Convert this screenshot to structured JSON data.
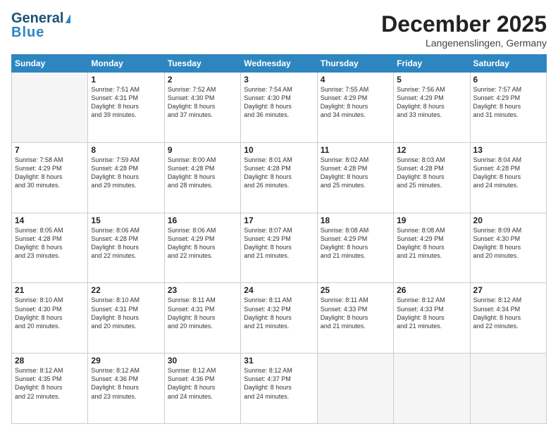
{
  "header": {
    "logo_line1": "General",
    "logo_line2": "Blue",
    "month": "December 2025",
    "location": "Langenenslingen, Germany"
  },
  "days_of_week": [
    "Sunday",
    "Monday",
    "Tuesday",
    "Wednesday",
    "Thursday",
    "Friday",
    "Saturday"
  ],
  "weeks": [
    [
      {
        "day": "",
        "info": ""
      },
      {
        "day": "1",
        "info": "Sunrise: 7:51 AM\nSunset: 4:31 PM\nDaylight: 8 hours\nand 39 minutes."
      },
      {
        "day": "2",
        "info": "Sunrise: 7:52 AM\nSunset: 4:30 PM\nDaylight: 8 hours\nand 37 minutes."
      },
      {
        "day": "3",
        "info": "Sunrise: 7:54 AM\nSunset: 4:30 PM\nDaylight: 8 hours\nand 36 minutes."
      },
      {
        "day": "4",
        "info": "Sunrise: 7:55 AM\nSunset: 4:29 PM\nDaylight: 8 hours\nand 34 minutes."
      },
      {
        "day": "5",
        "info": "Sunrise: 7:56 AM\nSunset: 4:29 PM\nDaylight: 8 hours\nand 33 minutes."
      },
      {
        "day": "6",
        "info": "Sunrise: 7:57 AM\nSunset: 4:29 PM\nDaylight: 8 hours\nand 31 minutes."
      }
    ],
    [
      {
        "day": "7",
        "info": "Sunrise: 7:58 AM\nSunset: 4:29 PM\nDaylight: 8 hours\nand 30 minutes."
      },
      {
        "day": "8",
        "info": "Sunrise: 7:59 AM\nSunset: 4:28 PM\nDaylight: 8 hours\nand 29 minutes."
      },
      {
        "day": "9",
        "info": "Sunrise: 8:00 AM\nSunset: 4:28 PM\nDaylight: 8 hours\nand 28 minutes."
      },
      {
        "day": "10",
        "info": "Sunrise: 8:01 AM\nSunset: 4:28 PM\nDaylight: 8 hours\nand 26 minutes."
      },
      {
        "day": "11",
        "info": "Sunrise: 8:02 AM\nSunset: 4:28 PM\nDaylight: 8 hours\nand 25 minutes."
      },
      {
        "day": "12",
        "info": "Sunrise: 8:03 AM\nSunset: 4:28 PM\nDaylight: 8 hours\nand 25 minutes."
      },
      {
        "day": "13",
        "info": "Sunrise: 8:04 AM\nSunset: 4:28 PM\nDaylight: 8 hours\nand 24 minutes."
      }
    ],
    [
      {
        "day": "14",
        "info": "Sunrise: 8:05 AM\nSunset: 4:28 PM\nDaylight: 8 hours\nand 23 minutes."
      },
      {
        "day": "15",
        "info": "Sunrise: 8:06 AM\nSunset: 4:28 PM\nDaylight: 8 hours\nand 22 minutes."
      },
      {
        "day": "16",
        "info": "Sunrise: 8:06 AM\nSunset: 4:29 PM\nDaylight: 8 hours\nand 22 minutes."
      },
      {
        "day": "17",
        "info": "Sunrise: 8:07 AM\nSunset: 4:29 PM\nDaylight: 8 hours\nand 21 minutes."
      },
      {
        "day": "18",
        "info": "Sunrise: 8:08 AM\nSunset: 4:29 PM\nDaylight: 8 hours\nand 21 minutes."
      },
      {
        "day": "19",
        "info": "Sunrise: 8:08 AM\nSunset: 4:29 PM\nDaylight: 8 hours\nand 21 minutes."
      },
      {
        "day": "20",
        "info": "Sunrise: 8:09 AM\nSunset: 4:30 PM\nDaylight: 8 hours\nand 20 minutes."
      }
    ],
    [
      {
        "day": "21",
        "info": "Sunrise: 8:10 AM\nSunset: 4:30 PM\nDaylight: 8 hours\nand 20 minutes."
      },
      {
        "day": "22",
        "info": "Sunrise: 8:10 AM\nSunset: 4:31 PM\nDaylight: 8 hours\nand 20 minutes."
      },
      {
        "day": "23",
        "info": "Sunrise: 8:11 AM\nSunset: 4:31 PM\nDaylight: 8 hours\nand 20 minutes."
      },
      {
        "day": "24",
        "info": "Sunrise: 8:11 AM\nSunset: 4:32 PM\nDaylight: 8 hours\nand 21 minutes."
      },
      {
        "day": "25",
        "info": "Sunrise: 8:11 AM\nSunset: 4:33 PM\nDaylight: 8 hours\nand 21 minutes."
      },
      {
        "day": "26",
        "info": "Sunrise: 8:12 AM\nSunset: 4:33 PM\nDaylight: 8 hours\nand 21 minutes."
      },
      {
        "day": "27",
        "info": "Sunrise: 8:12 AM\nSunset: 4:34 PM\nDaylight: 8 hours\nand 22 minutes."
      }
    ],
    [
      {
        "day": "28",
        "info": "Sunrise: 8:12 AM\nSunset: 4:35 PM\nDaylight: 8 hours\nand 22 minutes."
      },
      {
        "day": "29",
        "info": "Sunrise: 8:12 AM\nSunset: 4:36 PM\nDaylight: 8 hours\nand 23 minutes."
      },
      {
        "day": "30",
        "info": "Sunrise: 8:12 AM\nSunset: 4:36 PM\nDaylight: 8 hours\nand 24 minutes."
      },
      {
        "day": "31",
        "info": "Sunrise: 8:12 AM\nSunset: 4:37 PM\nDaylight: 8 hours\nand 24 minutes."
      },
      {
        "day": "",
        "info": ""
      },
      {
        "day": "",
        "info": ""
      },
      {
        "day": "",
        "info": ""
      }
    ]
  ]
}
